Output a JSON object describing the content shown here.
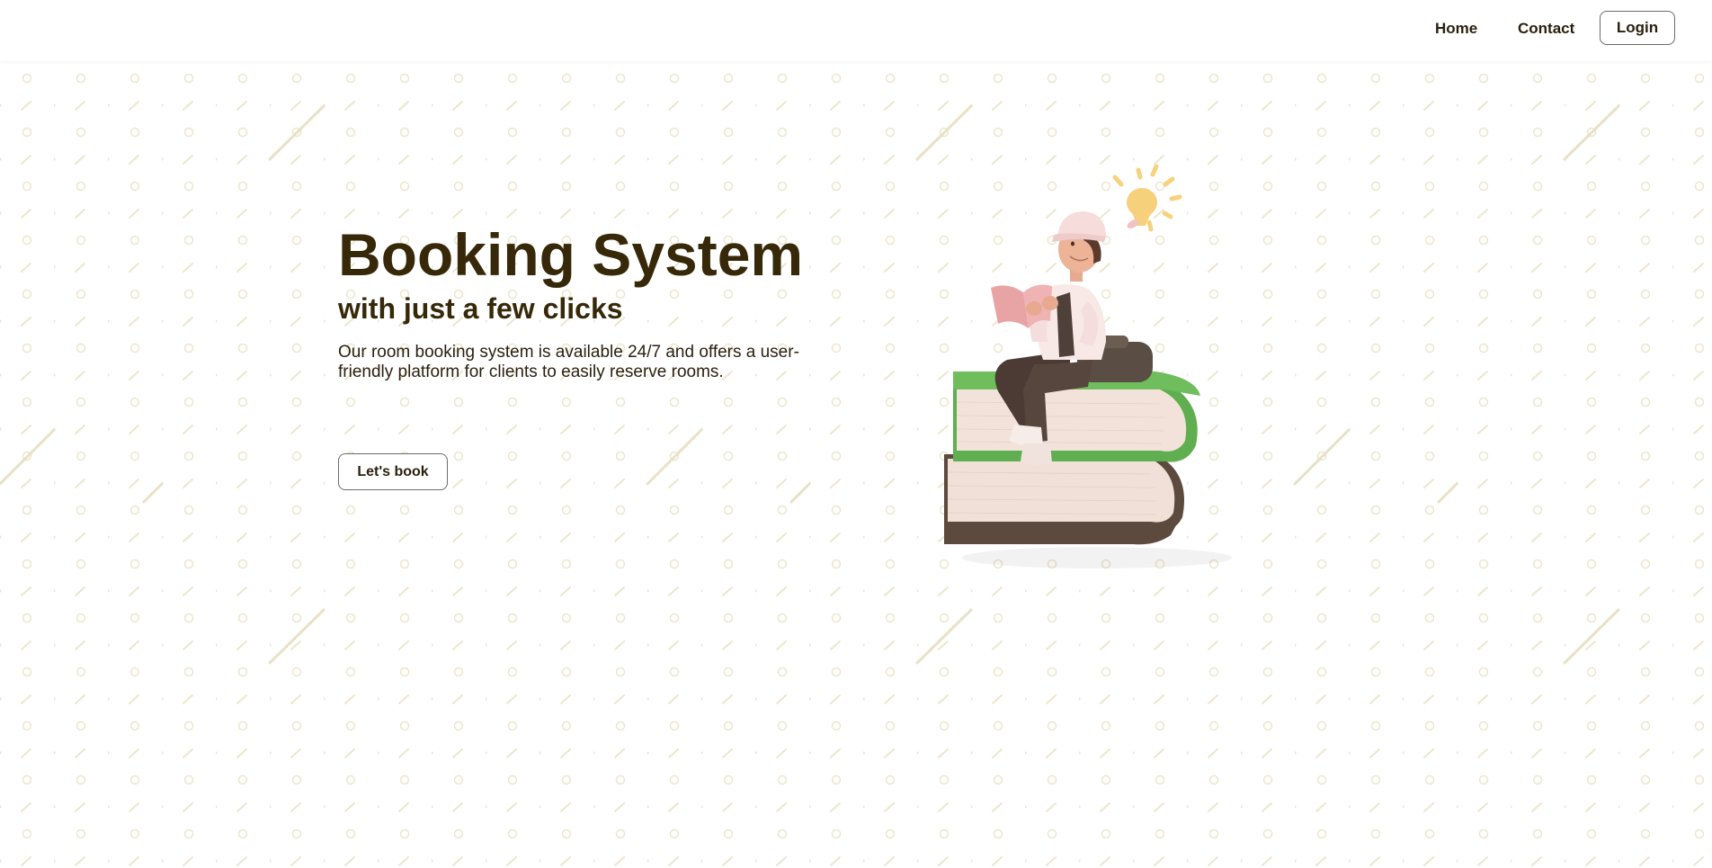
{
  "nav": {
    "home": "Home",
    "contact": "Contact",
    "login": "Login"
  },
  "hero": {
    "title": "Booking System",
    "subtitle": "with just a few clicks",
    "description": "Our room booking system is available 24/7 and offers a user-friendly platform for clients to easily reserve rooms.",
    "cta": "Let's book"
  },
  "illustration": {
    "icon": "person-reading-on-books-icon",
    "lightbulb": "lightbulb-icon"
  },
  "colors": {
    "text_dark": "#362808",
    "pattern": "#ece7cf",
    "book_green": "#5fae4f",
    "book_brown": "#5c4a3e"
  }
}
